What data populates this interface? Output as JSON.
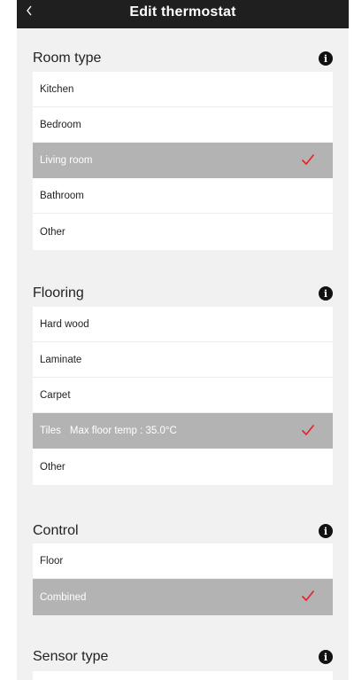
{
  "header": {
    "title": "Edit thermostat",
    "back_icon": "chevron-left-icon"
  },
  "accent_color": "#e8202a",
  "sections": {
    "room_type": {
      "title": "Room type",
      "items": [
        {
          "label": "Kitchen"
        },
        {
          "label": "Bedroom"
        },
        {
          "label": "Living room",
          "selected": true
        },
        {
          "label": "Bathroom"
        },
        {
          "label": "Other"
        }
      ]
    },
    "flooring": {
      "title": "Flooring",
      "items": [
        {
          "label": "Hard wood"
        },
        {
          "label": "Laminate"
        },
        {
          "label": "Carpet"
        },
        {
          "label": "Tiles",
          "sublabel": "Max floor temp : 35.0°C",
          "selected": true
        },
        {
          "label": "Other"
        }
      ]
    },
    "control": {
      "title": "Control",
      "items": [
        {
          "label": "Floor"
        },
        {
          "label": "Combined",
          "selected": true
        }
      ]
    },
    "sensor_type": {
      "title": "Sensor type"
    }
  }
}
